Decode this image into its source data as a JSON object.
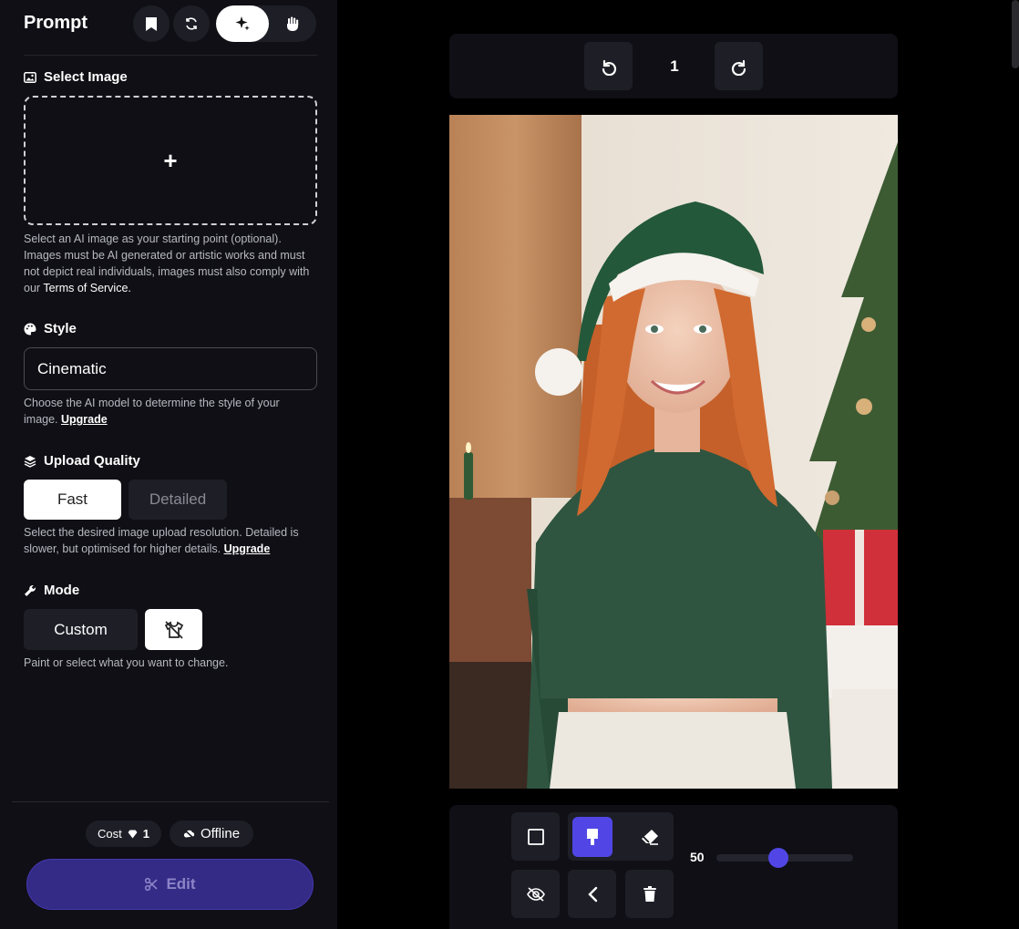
{
  "header": {
    "title": "Prompt",
    "bookmark_icon": "bookmark-icon",
    "refresh_icon": "refresh-icon",
    "magic_icon": "sparkle-icon",
    "hand_icon": "hand-icon"
  },
  "select_image": {
    "heading": "Select Image",
    "plus": "+",
    "help_text": "Select an AI image as your starting point (optional). Images must be AI generated or artistic works and must not depict real individuals, images must also comply with our ",
    "tos_link": "Terms of Service."
  },
  "style": {
    "heading": "Style",
    "value": "Cinematic",
    "help_text": "Choose the AI model to determine the style of your image. ",
    "upgrade_link": "Upgrade"
  },
  "upload_quality": {
    "heading": "Upload Quality",
    "options": [
      "Fast",
      "Detailed"
    ],
    "selected": "Fast",
    "help_text": "Select the desired image upload resolution. Detailed is slower, but optimised for higher details. ",
    "upgrade_link": "Upgrade"
  },
  "mode": {
    "heading": "Mode",
    "custom_label": "Custom",
    "help_text": "Paint or select what you want to change."
  },
  "footer": {
    "cost_label": "Cost",
    "cost_value": "1",
    "status": "Offline",
    "edit_label": "Edit"
  },
  "canvas_toolbar": {
    "page_number": "1"
  },
  "brush": {
    "size": "50",
    "size_fraction": 0.5
  },
  "colors": {
    "accent": "#5146e5",
    "edit_button": "#332b86",
    "panel": "#0f0f15"
  }
}
